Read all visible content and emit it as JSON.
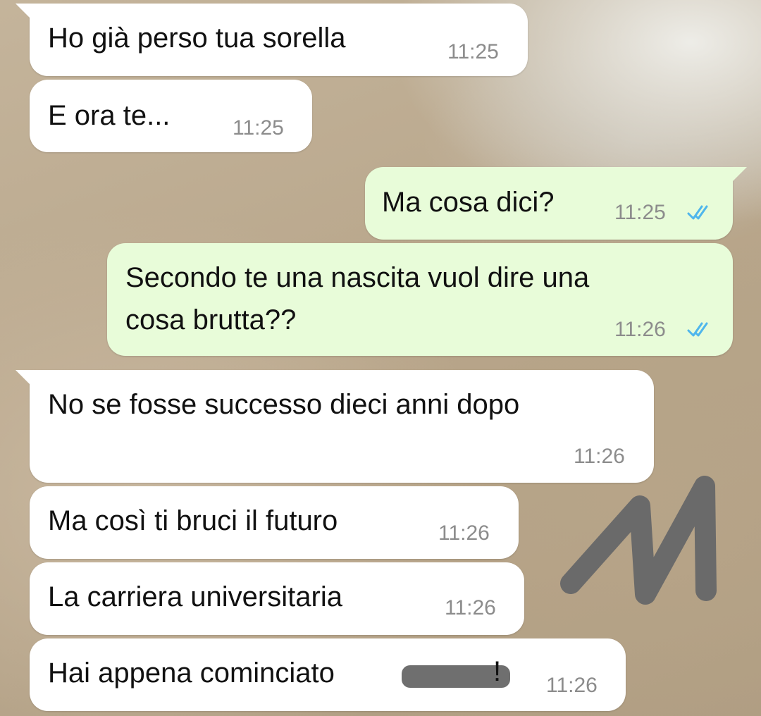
{
  "messages": [
    {
      "id": "m1",
      "direction": "incoming",
      "text": "Ho già perso tua sorella",
      "time": "11:25"
    },
    {
      "id": "m2",
      "direction": "incoming",
      "text": "E ora te...",
      "time": "11:25"
    },
    {
      "id": "m3",
      "direction": "outgoing",
      "text": "Ma cosa dici?",
      "time": "11:25",
      "status": "read-double-check-icon"
    },
    {
      "id": "m4",
      "direction": "outgoing",
      "text_line1": "Secondo te una nascita vuol dire una",
      "text_line2": "cosa brutta??",
      "time": "11:26",
      "status": "read-double-check-icon"
    },
    {
      "id": "m5",
      "direction": "incoming",
      "text": "No se fosse successo dieci anni dopo",
      "time": "11:26"
    },
    {
      "id": "m6",
      "direction": "incoming",
      "text": "Ma così ti bruci il futuro",
      "time": "11:26"
    },
    {
      "id": "m7",
      "direction": "incoming",
      "text": "La carriera universitaria",
      "time": "11:26"
    },
    {
      "id": "m8",
      "direction": "incoming",
      "text_before": "Hai appena cominciato",
      "text_after": "!",
      "time": "11:26",
      "redacted": true
    }
  ],
  "colors": {
    "incoming_bubble": "#ffffff",
    "outgoing_bubble": "#e8fcd9",
    "read_ticks": "#4fb6ec",
    "timestamp": "#8c8c8c",
    "redaction": "#6f6f6f"
  }
}
